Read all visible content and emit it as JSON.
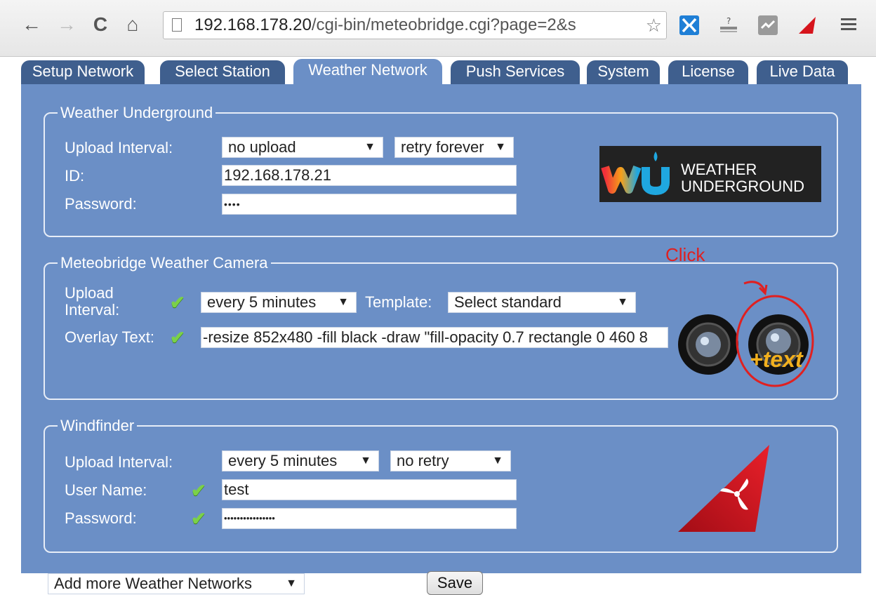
{
  "browser": {
    "url_host": "192.168.178.20",
    "url_rest": "/cgi-bin/meteobridge.cgi?page=2&s"
  },
  "tabs": [
    "Setup Network",
    "Select Station",
    "Weather Network",
    "Push Services",
    "System",
    "License",
    "Live Data"
  ],
  "active_tab": "Weather Network",
  "wunderground": {
    "legend": "Weather Underground",
    "upload_label": "Upload Interval:",
    "upload_value": "no upload",
    "retry_value": "retry forever",
    "id_label": "ID:",
    "id_value": "192.168.178.21",
    "password_label": "Password:",
    "password_value": "••••",
    "logo_line1": "WEATHER",
    "logo_line2": "UNDERGROUND"
  },
  "camera": {
    "legend": "Meteobridge Weather Camera",
    "upload_label_1": "Upload",
    "upload_label_2": "Interval:",
    "upload_value": "every 5 minutes",
    "template_label": "Template:",
    "template_value": "Select standard",
    "overlay_label": "Overlay Text:",
    "overlay_value": "-resize 852x480 -fill black -draw \"fill-opacity 0.7 rectangle 0 460 8",
    "text_badge": "+text",
    "annotation": "Click"
  },
  "windfinder": {
    "legend": "Windfinder",
    "upload_label": "Upload Interval:",
    "upload_value": "every 5 minutes",
    "retry_value": "no retry",
    "user_label": "User Name:",
    "user_value": "test",
    "password_label": "Password:",
    "password_value": "••••••••••••••••"
  },
  "footer": {
    "add_networks": "Add more Weather Networks",
    "save_label": "Save"
  },
  "colors": {
    "panel": "#6b8fc6",
    "tab_inactive": "#3f5f8e",
    "check": "#7bd148",
    "annotation": "#e02020"
  }
}
